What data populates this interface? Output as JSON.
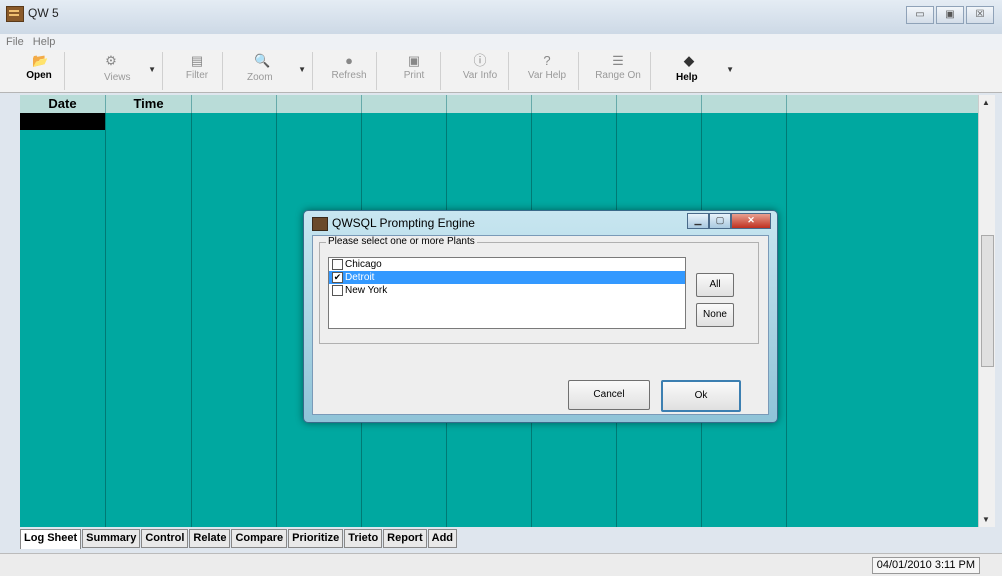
{
  "window": {
    "title": "QW 5",
    "buttons": [
      "▭",
      "▣",
      "☒"
    ]
  },
  "menu": {
    "items": [
      "File",
      "Help"
    ]
  },
  "toolbar": {
    "open": "Open",
    "views": "Views",
    "filter": "Filter",
    "zoom": "Zoom",
    "refresh": "Refresh",
    "print": "Print",
    "var_info": "Var Info",
    "var_help": "Var Help",
    "range_on": "Range On",
    "help": "Help"
  },
  "grid": {
    "col_date": "Date",
    "col_time": "Time"
  },
  "tabs": [
    "Log Sheet",
    "Summary",
    "Control",
    "Relate",
    "Compare",
    "Prioritize",
    "Trieto",
    "Report",
    "Add"
  ],
  "status": {
    "datetime": "04/01/2010 3:11 PM"
  },
  "dialog": {
    "title": "QWSQL Prompting Engine",
    "group_label": "Please select one or more Plants",
    "items": [
      {
        "label": "Chicago",
        "checked": false
      },
      {
        "label": "Detroit",
        "checked": true
      },
      {
        "label": "New York",
        "checked": false
      }
    ],
    "all_button": "All",
    "none_button": "None",
    "cancel_button": "Cancel",
    "ok_button": "Ok"
  }
}
